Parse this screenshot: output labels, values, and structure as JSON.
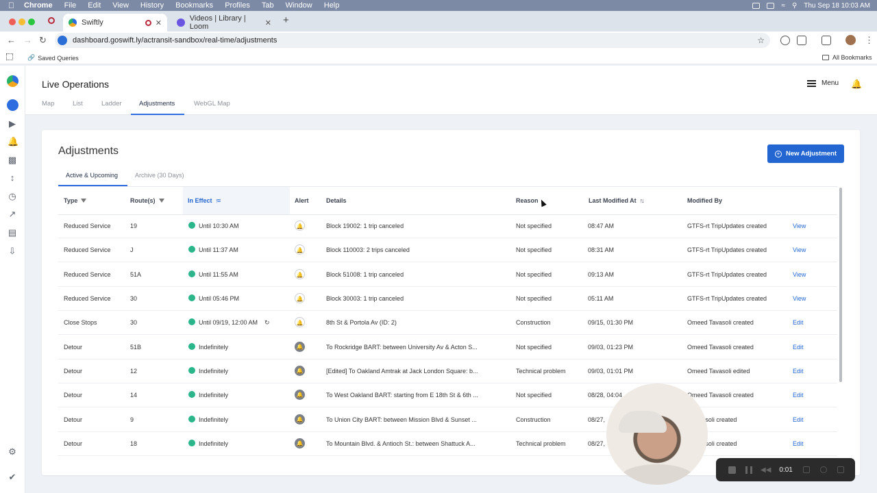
{
  "mac_menu": {
    "app": "Chrome",
    "items": [
      "File",
      "Edit",
      "View",
      "History",
      "Bookmarks",
      "Profiles",
      "Tab",
      "Window",
      "Help"
    ],
    "clock": "Thu Sep 18  10:03 AM"
  },
  "browser": {
    "tabs": [
      {
        "title": "Swiftly",
        "active": true
      },
      {
        "title": "Videos | Library | Loom",
        "active": false
      }
    ],
    "url": "dashboard.goswift.ly/actransit-sandbox/real-time/adjustments",
    "bookmarks": {
      "saved_queries": "Saved Queries",
      "all_bookmarks": "All Bookmarks"
    }
  },
  "app": {
    "title": "Live Operations",
    "tabs": [
      "Map",
      "List",
      "Ladder",
      "Adjustments",
      "WebGL Map"
    ],
    "active_tab": "Adjustments",
    "menu_label": "Menu"
  },
  "adjustments": {
    "title": "Adjustments",
    "new_button": "New Adjustment",
    "subtabs": [
      "Active & Upcoming",
      "Archive (30 Days)"
    ],
    "columns": {
      "type": "Type",
      "routes": "Route(s)",
      "in_effect": "In Effect",
      "alert": "Alert",
      "details": "Details",
      "reason": "Reason",
      "last_modified": "Last Modified At",
      "modified_by": "Modified By"
    },
    "rows": [
      {
        "type": "Reduced Service",
        "route": "19",
        "in_effect": "Until 10:30 AM",
        "alert": false,
        "details": "Block 19002: 1 trip canceled",
        "reason": "Not specified",
        "modified": "08:47 AM",
        "by": "GTFS-rt TripUpdates created",
        "action": "View"
      },
      {
        "type": "Reduced Service",
        "route": "J",
        "in_effect": "Until 11:37 AM",
        "alert": false,
        "details": "Block 110003: 2 trips canceled",
        "reason": "Not specified",
        "modified": "08:31 AM",
        "by": "GTFS-rt TripUpdates created",
        "action": "View"
      },
      {
        "type": "Reduced Service",
        "route": "51A",
        "in_effect": "Until 11:55 AM",
        "alert": false,
        "details": "Block 51008: 1 trip canceled",
        "reason": "Not specified",
        "modified": "09:13 AM",
        "by": "GTFS-rt TripUpdates created",
        "action": "View"
      },
      {
        "type": "Reduced Service",
        "route": "30",
        "in_effect": "Until 05:46 PM",
        "alert": false,
        "details": "Block 30003: 1 trip canceled",
        "reason": "Not specified",
        "modified": "05:11 AM",
        "by": "GTFS-rt TripUpdates created",
        "action": "View"
      },
      {
        "type": "Close Stops",
        "route": "30",
        "in_effect": "Until 09/19, 12:00 AM",
        "recurring": true,
        "alert": false,
        "details": "8th St & Portola Av (ID: 2)",
        "reason": "Construction",
        "modified": "09/15, 01:30 PM",
        "by": "Omeed Tavasoli created",
        "action": "Edit"
      },
      {
        "type": "Detour",
        "route": "51B",
        "in_effect": "Indefinitely",
        "alert": true,
        "details": "To Rockridge BART: between University Av & Acton S...",
        "reason": "Not specified",
        "modified": "09/03, 01:23 PM",
        "by": "Omeed Tavasoli created",
        "action": "Edit"
      },
      {
        "type": "Detour",
        "route": "12",
        "in_effect": "Indefinitely",
        "alert": true,
        "details": "[Edited] To Oakland Amtrak at Jack London Square: b...",
        "reason": "Technical problem",
        "modified": "09/03, 01:01 PM",
        "by": "Omeed Tavasoli edited",
        "action": "Edit"
      },
      {
        "type": "Detour",
        "route": "14",
        "in_effect": "Indefinitely",
        "alert": true,
        "details": "To West Oakland BART: starting from E 18th St & 6th ...",
        "reason": "Not specified",
        "modified": "08/28, 04:04",
        "by": "Omeed Tavasoli created",
        "action": "Edit"
      },
      {
        "type": "Detour",
        "route": "9",
        "in_effect": "Indefinitely",
        "alert": true,
        "details": "To Union City BART: between Mission Blvd & Sunset ...",
        "reason": "Construction",
        "modified": "08/27,",
        "by": "d Tavasoli created",
        "action": "Edit"
      },
      {
        "type": "Detour",
        "route": "18",
        "in_effect": "Indefinitely",
        "alert": true,
        "details": "To Mountain Blvd. & Antioch St.: between Shattuck A...",
        "reason": "Technical problem",
        "modified": "08/27,",
        "by": "d Tavasoli created",
        "action": "Edit"
      }
    ]
  },
  "loom": {
    "timer": "0:01"
  },
  "colors": {
    "accent": "#2366d1",
    "status_active": "#2bb58a",
    "menubar": "#7d8aa6"
  }
}
